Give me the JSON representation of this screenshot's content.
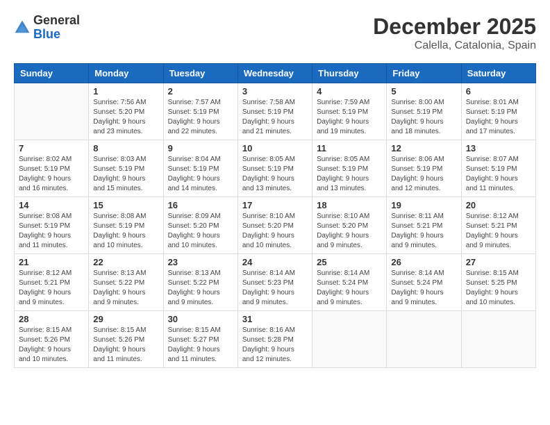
{
  "logo": {
    "general": "General",
    "blue": "Blue"
  },
  "title": "December 2025",
  "location": "Calella, Catalonia, Spain",
  "days_of_week": [
    "Sunday",
    "Monday",
    "Tuesday",
    "Wednesday",
    "Thursday",
    "Friday",
    "Saturday"
  ],
  "weeks": [
    [
      {
        "day": "",
        "info": ""
      },
      {
        "day": "1",
        "info": "Sunrise: 7:56 AM\nSunset: 5:20 PM\nDaylight: 9 hours\nand 23 minutes."
      },
      {
        "day": "2",
        "info": "Sunrise: 7:57 AM\nSunset: 5:19 PM\nDaylight: 9 hours\nand 22 minutes."
      },
      {
        "day": "3",
        "info": "Sunrise: 7:58 AM\nSunset: 5:19 PM\nDaylight: 9 hours\nand 21 minutes."
      },
      {
        "day": "4",
        "info": "Sunrise: 7:59 AM\nSunset: 5:19 PM\nDaylight: 9 hours\nand 19 minutes."
      },
      {
        "day": "5",
        "info": "Sunrise: 8:00 AM\nSunset: 5:19 PM\nDaylight: 9 hours\nand 18 minutes."
      },
      {
        "day": "6",
        "info": "Sunrise: 8:01 AM\nSunset: 5:19 PM\nDaylight: 9 hours\nand 17 minutes."
      }
    ],
    [
      {
        "day": "7",
        "info": "Sunrise: 8:02 AM\nSunset: 5:19 PM\nDaylight: 9 hours\nand 16 minutes."
      },
      {
        "day": "8",
        "info": "Sunrise: 8:03 AM\nSunset: 5:19 PM\nDaylight: 9 hours\nand 15 minutes."
      },
      {
        "day": "9",
        "info": "Sunrise: 8:04 AM\nSunset: 5:19 PM\nDaylight: 9 hours\nand 14 minutes."
      },
      {
        "day": "10",
        "info": "Sunrise: 8:05 AM\nSunset: 5:19 PM\nDaylight: 9 hours\nand 13 minutes."
      },
      {
        "day": "11",
        "info": "Sunrise: 8:05 AM\nSunset: 5:19 PM\nDaylight: 9 hours\nand 13 minutes."
      },
      {
        "day": "12",
        "info": "Sunrise: 8:06 AM\nSunset: 5:19 PM\nDaylight: 9 hours\nand 12 minutes."
      },
      {
        "day": "13",
        "info": "Sunrise: 8:07 AM\nSunset: 5:19 PM\nDaylight: 9 hours\nand 11 minutes."
      }
    ],
    [
      {
        "day": "14",
        "info": "Sunrise: 8:08 AM\nSunset: 5:19 PM\nDaylight: 9 hours\nand 11 minutes."
      },
      {
        "day": "15",
        "info": "Sunrise: 8:08 AM\nSunset: 5:19 PM\nDaylight: 9 hours\nand 10 minutes."
      },
      {
        "day": "16",
        "info": "Sunrise: 8:09 AM\nSunset: 5:20 PM\nDaylight: 9 hours\nand 10 minutes."
      },
      {
        "day": "17",
        "info": "Sunrise: 8:10 AM\nSunset: 5:20 PM\nDaylight: 9 hours\nand 10 minutes."
      },
      {
        "day": "18",
        "info": "Sunrise: 8:10 AM\nSunset: 5:20 PM\nDaylight: 9 hours\nand 9 minutes."
      },
      {
        "day": "19",
        "info": "Sunrise: 8:11 AM\nSunset: 5:21 PM\nDaylight: 9 hours\nand 9 minutes."
      },
      {
        "day": "20",
        "info": "Sunrise: 8:12 AM\nSunset: 5:21 PM\nDaylight: 9 hours\nand 9 minutes."
      }
    ],
    [
      {
        "day": "21",
        "info": "Sunrise: 8:12 AM\nSunset: 5:21 PM\nDaylight: 9 hours\nand 9 minutes."
      },
      {
        "day": "22",
        "info": "Sunrise: 8:13 AM\nSunset: 5:22 PM\nDaylight: 9 hours\nand 9 minutes."
      },
      {
        "day": "23",
        "info": "Sunrise: 8:13 AM\nSunset: 5:22 PM\nDaylight: 9 hours\nand 9 minutes."
      },
      {
        "day": "24",
        "info": "Sunrise: 8:14 AM\nSunset: 5:23 PM\nDaylight: 9 hours\nand 9 minutes."
      },
      {
        "day": "25",
        "info": "Sunrise: 8:14 AM\nSunset: 5:24 PM\nDaylight: 9 hours\nand 9 minutes."
      },
      {
        "day": "26",
        "info": "Sunrise: 8:14 AM\nSunset: 5:24 PM\nDaylight: 9 hours\nand 9 minutes."
      },
      {
        "day": "27",
        "info": "Sunrise: 8:15 AM\nSunset: 5:25 PM\nDaylight: 9 hours\nand 10 minutes."
      }
    ],
    [
      {
        "day": "28",
        "info": "Sunrise: 8:15 AM\nSunset: 5:26 PM\nDaylight: 9 hours\nand 10 minutes."
      },
      {
        "day": "29",
        "info": "Sunrise: 8:15 AM\nSunset: 5:26 PM\nDaylight: 9 hours\nand 11 minutes."
      },
      {
        "day": "30",
        "info": "Sunrise: 8:15 AM\nSunset: 5:27 PM\nDaylight: 9 hours\nand 11 minutes."
      },
      {
        "day": "31",
        "info": "Sunrise: 8:16 AM\nSunset: 5:28 PM\nDaylight: 9 hours\nand 12 minutes."
      },
      {
        "day": "",
        "info": ""
      },
      {
        "day": "",
        "info": ""
      },
      {
        "day": "",
        "info": ""
      }
    ]
  ]
}
